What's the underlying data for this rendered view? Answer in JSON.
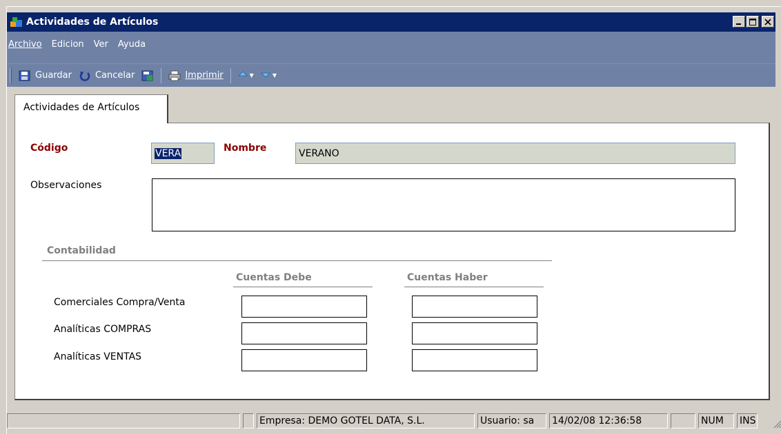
{
  "window": {
    "title": "Actividades de Artículos"
  },
  "menu": [
    {
      "label": "Archivo"
    },
    {
      "label": "Edicion"
    },
    {
      "label": "Ver"
    },
    {
      "label": "Ayuda"
    }
  ],
  "toolbar": {
    "save_label": "Guardar",
    "cancel_label": "Cancelar",
    "print_label": "Imprimir"
  },
  "tab": {
    "label": "Actividades de Artículos"
  },
  "form": {
    "codigo_label": "Código",
    "codigo_value": "VERA",
    "nombre_label": "Nombre",
    "nombre_value": "VERANO",
    "observaciones_label": "Observaciones",
    "observaciones_value": ""
  },
  "contabilidad": {
    "title": "Contabilidad",
    "col_debe": "Cuentas Debe",
    "col_haber": "Cuentas Haber",
    "rows": [
      {
        "label": "Comerciales Compra/Venta",
        "debe": "",
        "haber": ""
      },
      {
        "label": "Analíticas COMPRAS",
        "debe": "",
        "haber": ""
      },
      {
        "label": "Analíticas VENTAS",
        "debe": "",
        "haber": ""
      }
    ]
  },
  "statusbar": {
    "empresa": "Empresa: DEMO GOTEL DATA, S.L.",
    "usuario": "Usuario: sa",
    "datetime": "14/02/08 12:36:58",
    "num": "NUM",
    "ins": "INS"
  },
  "colors": {
    "titlebar": "#0a246a",
    "menubar": "#6f82a6",
    "required_label": "#8b0000"
  }
}
